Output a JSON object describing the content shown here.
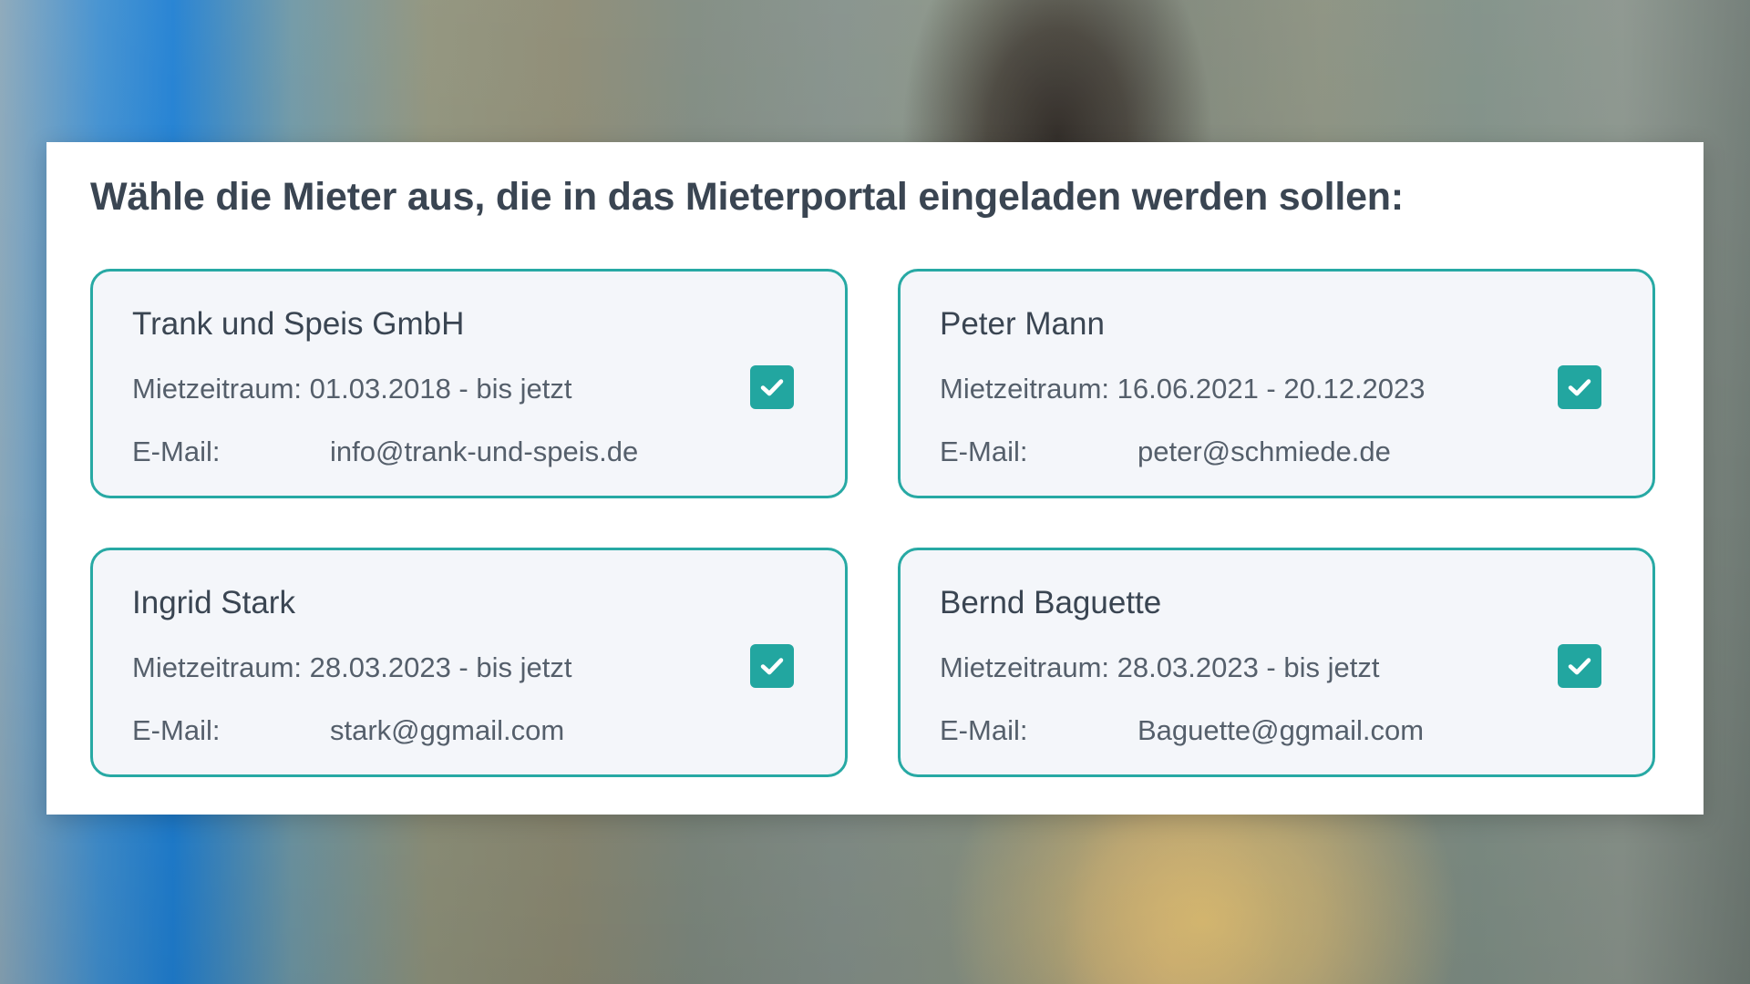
{
  "dialog": {
    "title": "Wähle die Mieter aus, die in das Mieterportal eingeladen werden sollen:"
  },
  "tenants": [
    {
      "name": "Trank und Speis GmbH",
      "period_label": "Mietzeitraum:",
      "period": "01.03.2018 - bis jetzt",
      "email_label": "E-Mail:",
      "email": "info@trank-und-speis.de",
      "selected": true
    },
    {
      "name": "Peter Mann",
      "period_label": "Mietzeitraum:",
      "period": "16.06.2021 - 20.12.2023",
      "email_label": "E-Mail:",
      "email": "peter@schmiede.de",
      "selected": true
    },
    {
      "name": "Ingrid Stark",
      "period_label": "Mietzeitraum:",
      "period": "28.03.2023 - bis jetzt",
      "email_label": "E-Mail:",
      "email": "stark@ggmail.com",
      "selected": true
    },
    {
      "name": "Bernd Baguette",
      "period_label": "Mietzeitraum:",
      "period": "28.03.2023 - bis jetzt",
      "email_label": "E-Mail:",
      "email": "Baguette@ggmail.com",
      "selected": true
    }
  ],
  "colors": {
    "accent": "#27a9a4",
    "card_background": "#f4f6fa",
    "title_text": "#3a4552",
    "body_text": "#555f6b"
  },
  "icons": {
    "checkbox": "checkmark-icon"
  }
}
